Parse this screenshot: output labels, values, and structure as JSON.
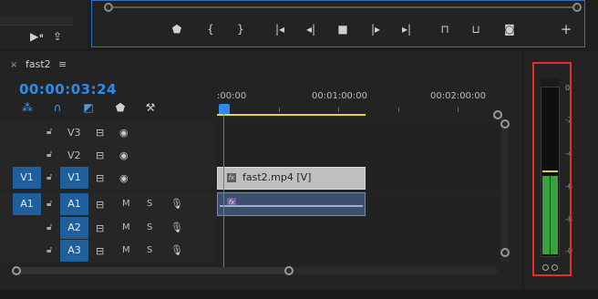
{
  "sequence": {
    "tab_close": "×",
    "tab_name": "fast2",
    "tab_menu": "≡",
    "timecode": "00:00:03:24"
  },
  "ruler": {
    "labels": [
      ":00:00",
      "00:01:00:00",
      "00:02:00:00"
    ]
  },
  "tracks": {
    "V3": {
      "label": "V3"
    },
    "V2": {
      "label": "V2"
    },
    "V1": {
      "source": "V1",
      "label": "V1"
    },
    "A1": {
      "source": "A1",
      "label": "A1",
      "m": "M",
      "s": "S"
    },
    "A2": {
      "label": "A2",
      "m": "M",
      "s": "S"
    },
    "A3": {
      "label": "A3",
      "m": "M",
      "s": "S"
    }
  },
  "clips": {
    "video": {
      "fx": "fx",
      "name": "fast2.mp4 [V]"
    },
    "audio": {
      "fx": "fx"
    }
  },
  "meter": {
    "scale": [
      "0",
      "-2",
      "-4",
      "-6",
      "-8",
      "-0"
    ],
    "level_fraction": 0.45
  },
  "colors": {
    "accent": "#2d8ceb",
    "workarea": "#e2d63a",
    "meter_green": "#37a33c",
    "highlight_box": "#e03030"
  },
  "icons": {
    "program_controls": [
      "add-marker-icon",
      "mark-in-icon",
      "mark-out-icon",
      "go-to-in-icon",
      "step-back-icon",
      "stop-icon",
      "play-icon",
      "go-to-out-icon",
      "lift-icon",
      "extract-icon",
      "export-frame-icon",
      "add-button-icon"
    ],
    "timeline_tools": [
      "snap-icon",
      "linked-selection-icon",
      "add-marker-tool-icon",
      "marker-icon",
      "wrench-icon"
    ]
  }
}
